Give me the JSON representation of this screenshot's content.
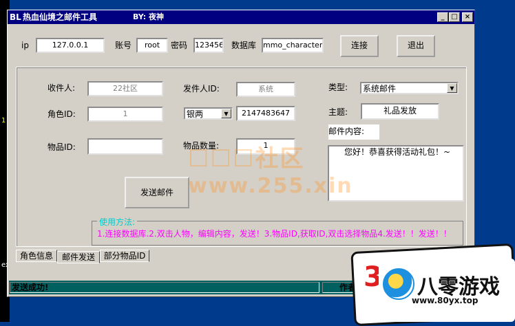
{
  "window": {
    "title_icon": "BL",
    "title": "热血仙境之邮件工具",
    "byline": "BY: 夜神",
    "controls": {
      "minimize": "_",
      "maximize": "□",
      "close": "×"
    }
  },
  "connection": {
    "ip_label": "ip",
    "ip_value": "127.0.0.1",
    "account_label": "账号",
    "account_value": "root",
    "password_label": "密码",
    "password_value": "123456",
    "db_label": "数据库",
    "db_value": "mmo_character",
    "connect_label": "连接",
    "exit_label": "退出"
  },
  "form": {
    "recipient_label": "收件人:",
    "recipient_value": "22社区",
    "sender_id_label": "发件人ID:",
    "sender_value": "系统",
    "type_label": "类型:",
    "type_value": "系统邮件",
    "role_id_label": "角色ID:",
    "role_id_value": "1",
    "currency_value": "银两",
    "currency_amount": "2147483647",
    "subject_label": "主题:",
    "subject_value": "礼品发放",
    "content_label": "邮件内容:",
    "content_value": "您好！恭喜获得活动礼包！~",
    "item_id_label": "物品ID:",
    "item_id_value": "",
    "item_qty_label": "物品数量:",
    "item_qty_value": "1",
    "send_label": "发送邮件"
  },
  "help": {
    "title": "使用方法:",
    "text": "1.连接数据库.2.双击人物，编辑内容，发送！3.物品ID,获取ID,双击选择物品4.发送！！发送！！"
  },
  "tabs": [
    {
      "label": "角色信息"
    },
    {
      "label": "邮件发送"
    },
    {
      "label": "部分物品ID"
    }
  ],
  "status": {
    "message": "发送成功!",
    "author_label": "作者"
  },
  "watermark": {
    "line1": "☐☐☐社区",
    "line2": "www.255.xin"
  },
  "logo": {
    "number": "3",
    "text": "八零游戏",
    "url": "www.80yx.top"
  },
  "desktop_marks": [
    "1",
    "x",
    "ex"
  ]
}
